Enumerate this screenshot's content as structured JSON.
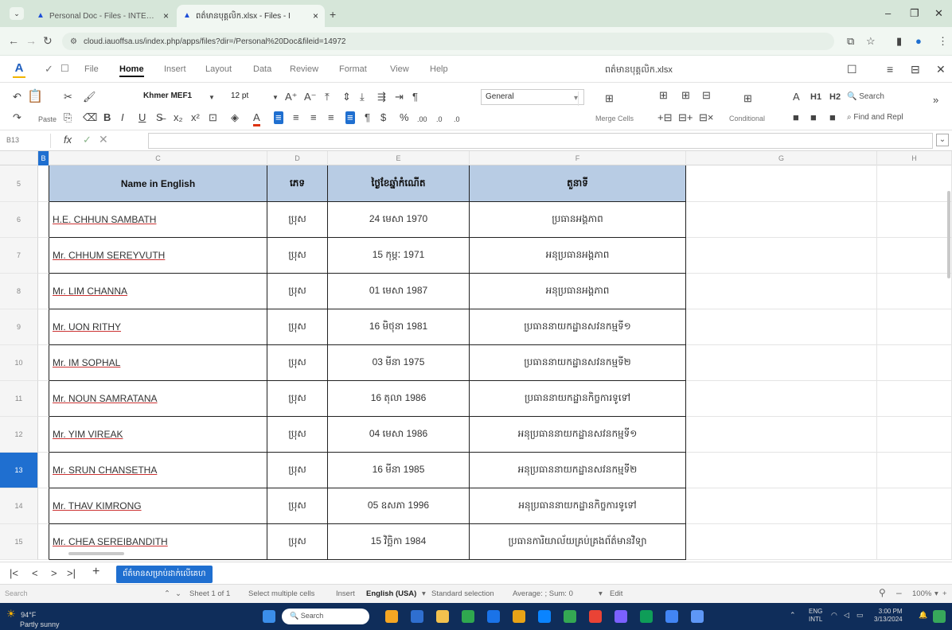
{
  "browser": {
    "tabs": [
      {
        "title": "Personal Doc - Files - INTERNAL A"
      },
      {
        "title": "ពត៌មានបុគ្គលិក.xlsx - Files - I"
      }
    ],
    "url": "cloud.iauoffsa.us/index.php/apps/files?dir=/Personal%20Doc&fileid=14972"
  },
  "menu": {
    "items": [
      "File",
      "Home",
      "Insert",
      "Layout",
      "Data",
      "Review",
      "Format",
      "View",
      "Help"
    ],
    "active": "Home",
    "document_name": "ពត៌មានបុគ្គលិក.xlsx"
  },
  "toolbar": {
    "paste_label": "Paste",
    "font_name": "Khmer MEF1",
    "font_size": "12 pt",
    "number_format": "General",
    "merge_label": "Merge Cells",
    "conditional_label": "Conditional",
    "search_label": "Search",
    "find_replace_label": "Find and Repl",
    "h1": "H1",
    "h2": "H2",
    "font_color_letter": "A"
  },
  "formula": {
    "cell_ref": "B13",
    "value": ""
  },
  "grid": {
    "columns": [
      "B",
      "C",
      "D",
      "E",
      "F",
      "G",
      "H"
    ],
    "header_row_number": "5",
    "headers": [
      "Name in English",
      "ភេទ",
      "ថ្ងៃខែឆ្នាំកំណើត",
      "តួនាទី"
    ],
    "rows": [
      {
        "num": "6",
        "name": "H.E. CHHUN SAMBATH",
        "sex": "ប្រុស",
        "dob": "24 មេសា 1970",
        "role": "ប្រធានអង្គភាព"
      },
      {
        "num": "7",
        "name": "Mr. CHHUM SEREYVUTH",
        "sex": "ប្រុស",
        "dob": "15 កុម្ភៈ 1971",
        "role": "អនុប្រធានអង្គភាព"
      },
      {
        "num": "8",
        "name": "Mr. LIM CHANNA",
        "sex": "ប្រុស",
        "dob": "01 មេសា 1987",
        "role": "អនុប្រធានអង្គភាព"
      },
      {
        "num": "9",
        "name": "Mr. UON RITHY",
        "sex": "ប្រុស",
        "dob": "16 មិថុនា 1981",
        "role": "ប្រធាននាយកដ្ឋានសវនកម្មទី១"
      },
      {
        "num": "10",
        "name": "Mr. IM SOPHAL",
        "sex": "ប្រុស",
        "dob": "03 មីនា 1975",
        "role": "ប្រធាននាយកដ្ឋានសវនកម្មទី២"
      },
      {
        "num": "11",
        "name": "Mr. NOUN SAMRATANA",
        "sex": "ប្រុស",
        "dob": "16 តុលា 1986",
        "role": "ប្រធាននាយកដ្ឋានកិច្ចការទូទៅ"
      },
      {
        "num": "12",
        "name": "Mr. YIM VIREAK",
        "sex": "ប្រុស",
        "dob": "04 មេសា 1986",
        "role": "អនុប្រធាននាយកដ្ឋានសវនកម្មទី១"
      },
      {
        "num": "13",
        "name": "Mr. SRUN CHANSETHA",
        "sex": "ប្រុស",
        "dob": "16 មីនា 1985",
        "role": "អនុប្រធាននាយកដ្ឋានសវនកម្មទី២"
      },
      {
        "num": "14",
        "name": "Mr. THAV KIMRONG",
        "sex": "ប្រុស",
        "dob": "05 ឧសភា 1996",
        "role": "អនុប្រធាននាយកដ្ឋានកិច្ចការទូទៅ"
      },
      {
        "num": "15",
        "name": "Mr. CHEA SEREIBANDITH",
        "sex": "ប្រុស",
        "dob": "15 វិច្ឆិកា 1984",
        "role": "ប្រធានការិយាល័យគ្រប់គ្រងព័ត៌មានវិទ្យា"
      }
    ],
    "selected_row": "13"
  },
  "sheets": {
    "active": "ព័ត៌មានសម្រាប់ដាក់លើគេហ"
  },
  "status": {
    "search_placeholder": "Search",
    "sheet_count": "Sheet 1 of 1",
    "select_multiple": "Select multiple cells",
    "insert": "Insert",
    "language": "English (USA)",
    "selection_mode": "Standard selection",
    "aggregate": "Average: ; Sum: 0",
    "edit": "Edit",
    "zoom": "100%"
  },
  "taskbar": {
    "temperature": "94°F",
    "weather": "Partly sunny",
    "search": "Search",
    "lang": "ENG",
    "lang2": "INTL",
    "time": "3:00 PM",
    "date": "3/13/2024"
  }
}
